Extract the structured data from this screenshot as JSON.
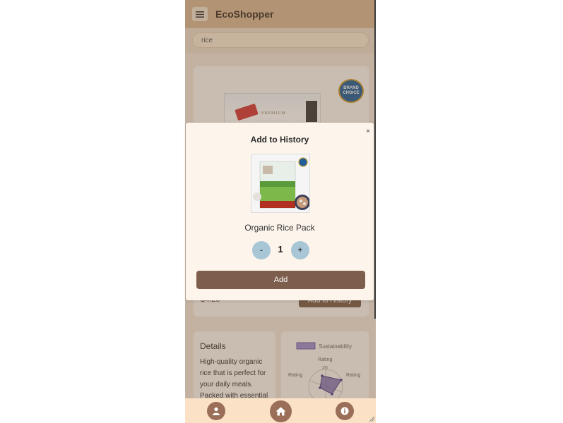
{
  "header": {
    "title": "EcoShopper"
  },
  "search": {
    "value": "rice"
  },
  "product": {
    "badge_text": "BRAND CHOICE",
    "price": "$4.25",
    "add_button": "Add to History",
    "packaging_word": "PREMIUM"
  },
  "details": {
    "title": "Details",
    "description": "High-quality organic rice that is perfect for your daily meals. Packed with essential"
  },
  "chart_data": {
    "type": "radar",
    "legend": [
      "Sustainability"
    ],
    "axis_labels": [
      "Rating",
      "Rating",
      "Rating"
    ],
    "tick_labels": [
      "20"
    ]
  },
  "modal": {
    "title": "Add to History",
    "close": "×",
    "product_name": "Organic Rice Pack",
    "quantity": "1",
    "minus": "-",
    "plus": "+",
    "add_button": "Add"
  },
  "nav": {
    "items": [
      {
        "icon": "user-icon"
      },
      {
        "icon": "home-icon"
      },
      {
        "icon": "info-icon"
      }
    ]
  },
  "colors": {
    "header_bg": "#d8b896",
    "accent_brown": "#7d5e4d",
    "qty_button": "#a8c6d6",
    "nav_bg": "#fbe1c6",
    "chart_fill": "#6a5aa8"
  }
}
